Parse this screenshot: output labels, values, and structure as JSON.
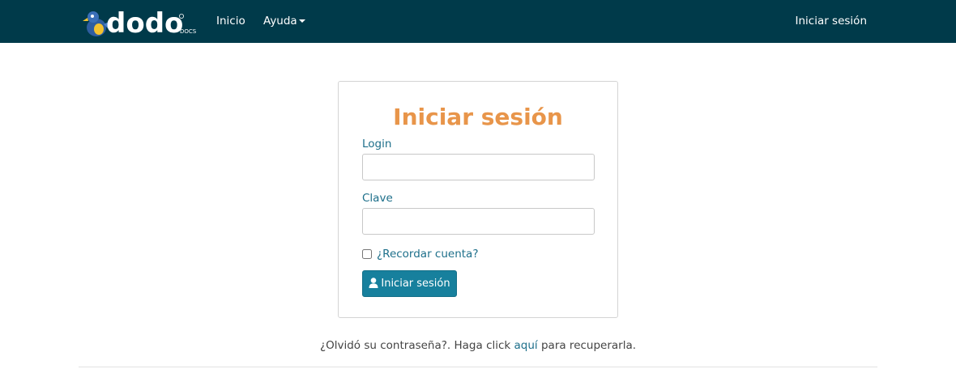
{
  "navbar": {
    "logo_text": "dodo",
    "logo_sub": "DOCS",
    "links": {
      "inicio": "Inicio",
      "ayuda": "Ayuda"
    },
    "login_link": "Iniciar sesión",
    "background": "#003a4a"
  },
  "login_form": {
    "title": "Iniciar sesión",
    "login_label": "Login",
    "login_value": "",
    "password_label": "Clave",
    "password_value": "",
    "remember_label": "¿Recordar cuenta?",
    "remember_checked": false,
    "submit_label": "Iniciar sesión",
    "submit_icon": "user-icon",
    "title_color": "#e8954a",
    "accent_color": "#17809d"
  },
  "footer": {
    "forgot_prefix": "¿Olvidó su contraseña?. Haga click ",
    "forgot_link": "aquí",
    "forgot_suffix": " para recuperarla."
  }
}
